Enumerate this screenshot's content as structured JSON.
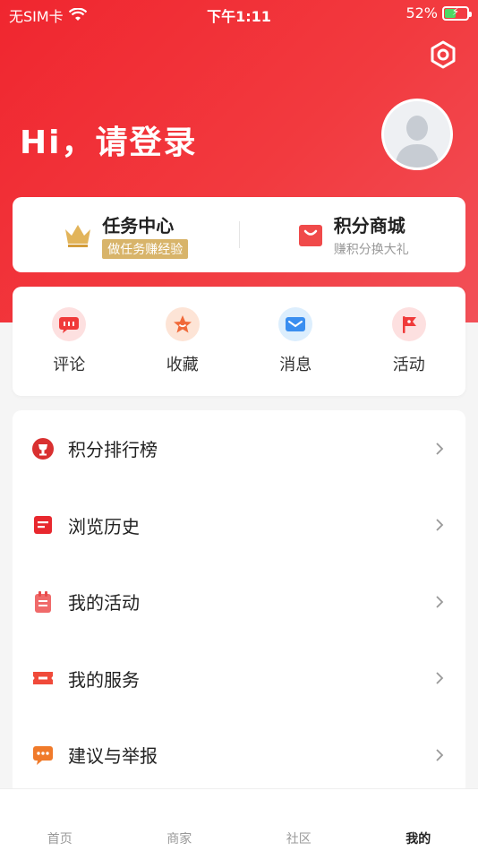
{
  "status": {
    "carrier": "无SIM卡",
    "time": "下午1:11",
    "battery_percent": "52%",
    "battery_level": 0.52
  },
  "header": {
    "greeting": "Hi，请登录"
  },
  "top_cards": [
    {
      "title": "任务中心",
      "subtitle": "做任务赚经验",
      "icon": "crown-icon"
    },
    {
      "title": "积分商城",
      "subtitle": "赚积分换大礼",
      "icon": "shopping-bag-icon"
    }
  ],
  "quick_actions": [
    {
      "label": "评论",
      "icon": "comment-icon"
    },
    {
      "label": "收藏",
      "icon": "star-icon"
    },
    {
      "label": "消息",
      "icon": "mail-icon"
    },
    {
      "label": "活动",
      "icon": "flag-icon"
    }
  ],
  "menu": [
    {
      "label": "积分排行榜",
      "icon": "trophy-icon"
    },
    {
      "label": "浏览历史",
      "icon": "history-icon"
    },
    {
      "label": "我的活动",
      "icon": "clipboard-icon"
    },
    {
      "label": "我的服务",
      "icon": "ticket-icon"
    },
    {
      "label": "建议与举报",
      "icon": "feedback-icon"
    }
  ],
  "tabs": [
    {
      "label": "首页",
      "active": false
    },
    {
      "label": "商家",
      "active": false
    },
    {
      "label": "社区",
      "active": false
    },
    {
      "label": "我的",
      "active": true
    }
  ],
  "colors": {
    "brand_red": "#f0262f",
    "gold": "#d8b46a"
  }
}
